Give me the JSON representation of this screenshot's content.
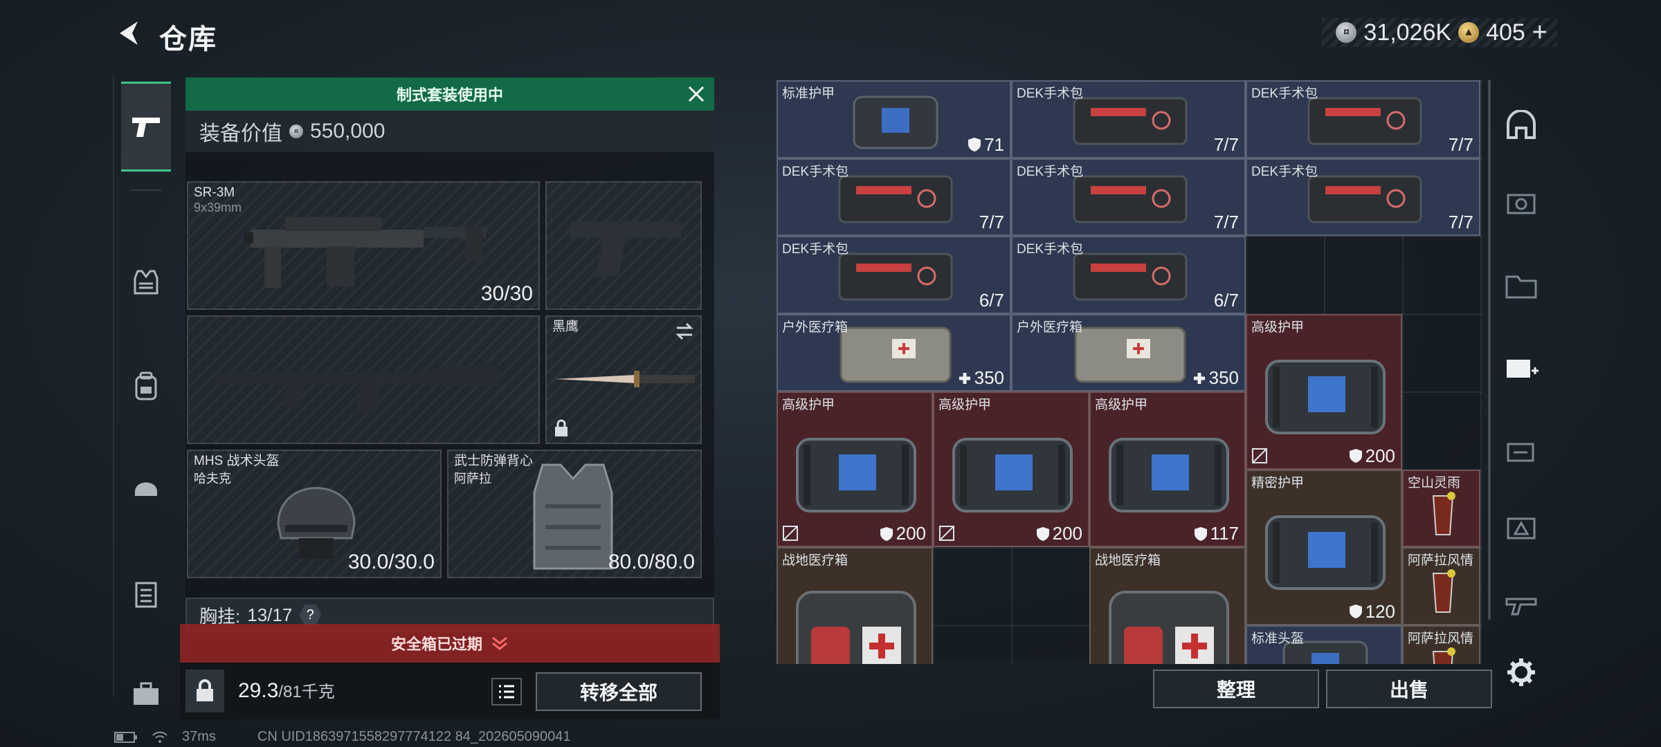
{
  "header": {
    "title": "仓库",
    "silver": "31,026K",
    "gold": "405",
    "add": "+"
  },
  "loadout": {
    "banner": "制式套装使用中",
    "value_label": "装备价值",
    "value": "550,000",
    "primary": {
      "name": "SR-3M",
      "ammo": "9x39mm",
      "count": "30/30"
    },
    "melee": {
      "name": "黑鹰"
    },
    "helmet": {
      "name": "MHS 战术头盔",
      "sub": "哈夫克",
      "count": "30.0/30.0"
    },
    "armor": {
      "name": "武士防弹背心",
      "sub": "阿萨拉",
      "count": "80.0/80.0"
    },
    "chest_label": "胸挂:",
    "chest_value": "13/17",
    "help": "?",
    "safebox": "安全箱已过期",
    "weight": "29.3",
    "weight_cap": "/81千克",
    "transfer": "转移全部"
  },
  "storage": {
    "items": [
      {
        "label": "标准护甲",
        "qty": "71",
        "kind": "shield"
      },
      {
        "label": "DEK手术包",
        "qty": "7/7"
      },
      {
        "label": "DEK手术包",
        "qty": "7/7"
      },
      {
        "label": "DEK手术包",
        "qty": "7/7"
      },
      {
        "label": "DEK手术包",
        "qty": "7/7"
      },
      {
        "label": "DEK手术包",
        "qty": "7/7"
      },
      {
        "label": "DEK手术包",
        "qty": "6/7"
      },
      {
        "label": "DEK手术包",
        "qty": "6/7"
      },
      {
        "label": "户外医疗箱",
        "qty": "350",
        "kind": "plus"
      },
      {
        "label": "户外医疗箱",
        "qty": "350",
        "kind": "plus"
      },
      {
        "label": "高级护甲",
        "qty": "200",
        "kind": "shield"
      },
      {
        "label": "高级护甲",
        "qty": "200",
        "kind": "shield"
      },
      {
        "label": "高级护甲",
        "qty": "200",
        "kind": "shield"
      },
      {
        "label": "高级护甲",
        "qty": "117",
        "kind": "shield"
      },
      {
        "label": "精密护甲",
        "qty": "120",
        "kind": "shield"
      },
      {
        "label": "空山灵雨",
        "qty": ""
      },
      {
        "label": "阿萨拉风情",
        "qty": ""
      },
      {
        "label": "战地医疗箱",
        "qty": ""
      },
      {
        "label": "战地医疗箱",
        "qty": ""
      },
      {
        "label": "标准头盔",
        "qty": ""
      },
      {
        "label": "阿萨拉风情",
        "qty": ""
      }
    ],
    "sort": "整理",
    "sell": "出售"
  },
  "status": {
    "ping": "37ms",
    "uid": "CN UID1863971558297774122 84_202605090041"
  },
  "colors": {
    "accent": "#126a46",
    "warning": "#962424",
    "rare_red": "#4a2329",
    "blue_cell": "#2e3850"
  }
}
